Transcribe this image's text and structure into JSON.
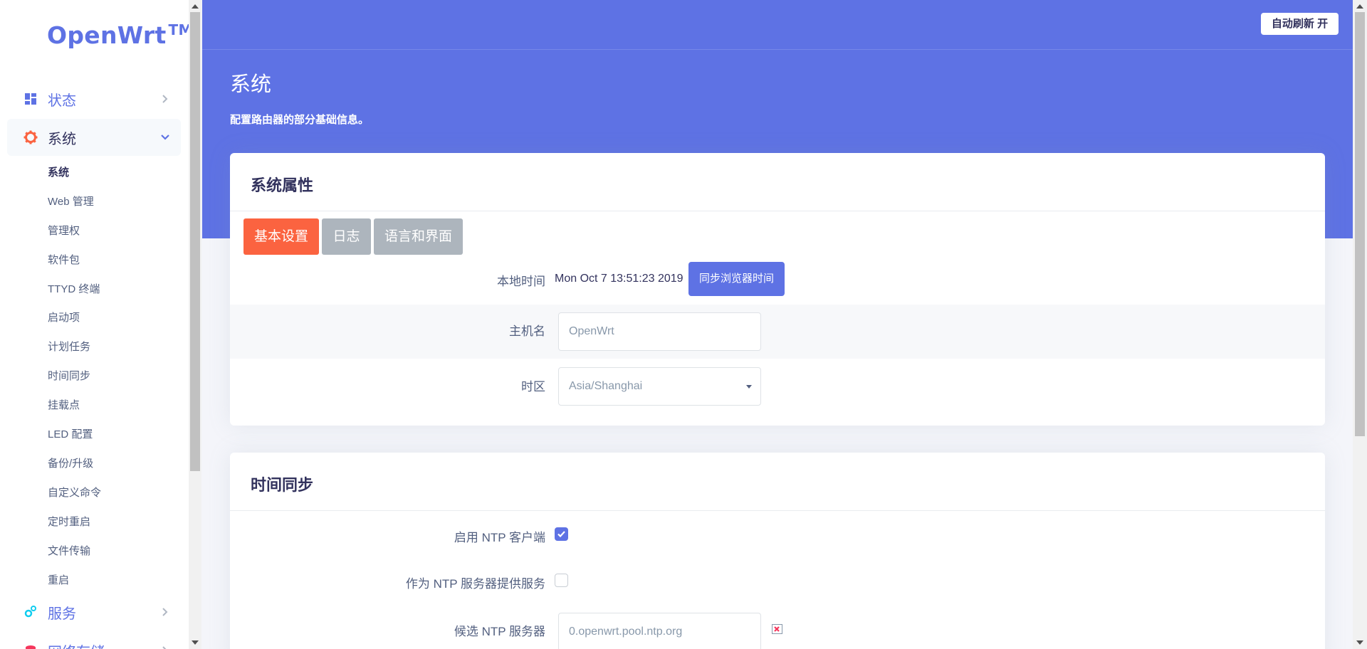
{
  "brand": {
    "name": "OpenWrt",
    "tm": "TM",
    "color": "#5e72e4"
  },
  "sidebar": {
    "main": [
      {
        "label": "状态",
        "icon": "dashboard-icon"
      },
      {
        "label": "系统",
        "icon": "gear-icon"
      },
      {
        "label": "服务",
        "icon": "gears-icon"
      },
      {
        "label": "网络存储",
        "icon": "storage-icon"
      }
    ],
    "sub": [
      {
        "label": "系统"
      },
      {
        "label": "Web 管理"
      },
      {
        "label": "管理权"
      },
      {
        "label": "软件包"
      },
      {
        "label": "TTYD 终端"
      },
      {
        "label": "启动项"
      },
      {
        "label": "计划任务"
      },
      {
        "label": "时间同步"
      },
      {
        "label": "挂载点"
      },
      {
        "label": "LED 配置"
      },
      {
        "label": "备份/升级"
      },
      {
        "label": "自定义命令"
      },
      {
        "label": "定时重启"
      },
      {
        "label": "文件传输"
      },
      {
        "label": "重启"
      }
    ]
  },
  "header": {
    "refresh_label": "自动刷新 开",
    "title": "系统",
    "description": "配置路由器的部分基础信息。"
  },
  "props_card": {
    "title": "系统属性",
    "tabs": [
      {
        "label": "基本设置",
        "active": true
      },
      {
        "label": "日志",
        "active": false
      },
      {
        "label": "语言和界面",
        "active": false
      }
    ],
    "local_time_label": "本地时间",
    "local_time_value": "Mon Oct 7 13:51:23 2019",
    "sync_button": "同步浏览器时间",
    "hostname_label": "主机名",
    "hostname_value": "OpenWrt",
    "timezone_label": "时区",
    "timezone_value": "Asia/Shanghai"
  },
  "ntp_card": {
    "title": "时间同步",
    "enable_client_label": "启用 NTP 客户端",
    "enable_client_checked": true,
    "provide_server_label": "作为 NTP 服务器提供服务",
    "provide_server_checked": false,
    "candidates_label": "候选 NTP 服务器",
    "candidate_1": "0.openwrt.pool.ntp.org"
  },
  "colors": {
    "primary": "#5e72e4",
    "accent": "#fb6340",
    "tab_inactive": "#adb5bd"
  }
}
